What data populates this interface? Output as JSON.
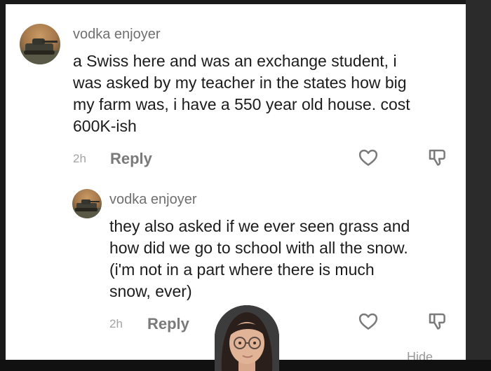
{
  "comments": [
    {
      "username": "vodka enjoyer",
      "lines": [
        "a Swiss here and was an exchange student, i",
        "was asked by my teacher in the states how big",
        "my farm was, i have a 550 year old house. cost",
        "600K-ish"
      ],
      "time": "2h",
      "reply_label": "Reply"
    },
    {
      "username": "vodka enjoyer",
      "lines": [
        "they also asked if we ever seen grass and",
        "how did we go to school with all the snow.",
        "(i'm not in a part where there is much",
        "snow, ever)"
      ],
      "time": "2h",
      "reply_label": "Reply"
    }
  ],
  "hide_label": "Hide",
  "icons": {
    "like": "heart-outline-icon",
    "dislike": "thumbs-down-icon"
  },
  "colors": {
    "text": "#1c1c1c",
    "muted": "#6f6f6f",
    "background": "#ffffff"
  }
}
